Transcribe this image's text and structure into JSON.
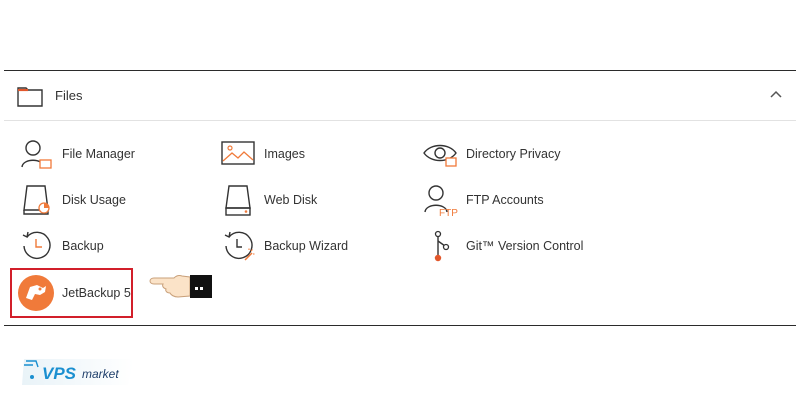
{
  "panel": {
    "title": "Files"
  },
  "items": [
    {
      "label": "File Manager",
      "icon": "file-manager-icon"
    },
    {
      "label": "Images",
      "icon": "images-icon"
    },
    {
      "label": "Directory Privacy",
      "icon": "directory-privacy-icon"
    },
    {
      "label": "Disk Usage",
      "icon": "disk-usage-icon"
    },
    {
      "label": "Web Disk",
      "icon": "web-disk-icon"
    },
    {
      "label": "FTP Accounts",
      "icon": "ftp-accounts-icon"
    },
    {
      "label": "Backup",
      "icon": "backup-icon"
    },
    {
      "label": "Backup Wizard",
      "icon": "backup-wizard-icon"
    },
    {
      "label": "Git™ Version Control",
      "icon": "git-icon"
    },
    {
      "label": "JetBackup 5",
      "icon": "jetbackup-icon"
    }
  ],
  "ftp_badge": "FTP",
  "logo": {
    "text_vps": "VPS",
    "text_market": "market"
  },
  "colors": {
    "accent": "#f07a3a",
    "highlight": "#d21f2a",
    "icon_stroke": "#333333"
  }
}
